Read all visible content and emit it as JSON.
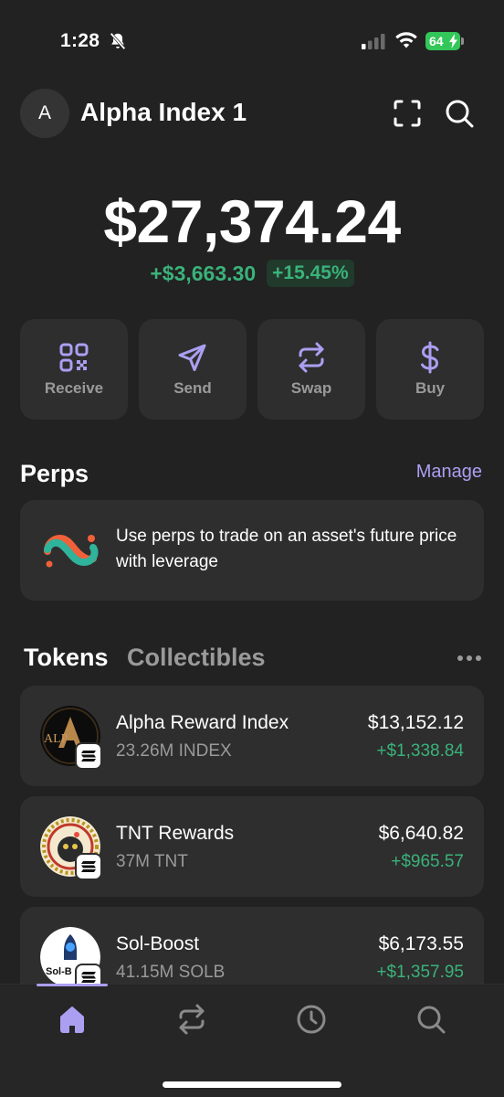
{
  "status_bar": {
    "time": "1:28",
    "battery": "64"
  },
  "header": {
    "avatar_letter": "A",
    "account_name": "Alpha Index 1"
  },
  "balance": {
    "total": "$27,374.24",
    "change_amount": "+$3,663.30",
    "change_percent": "+15.45%"
  },
  "actions": [
    {
      "label": "Receive",
      "icon": "qr-code-icon"
    },
    {
      "label": "Send",
      "icon": "send-arrow-icon"
    },
    {
      "label": "Swap",
      "icon": "swap-arrows-icon"
    },
    {
      "label": "Buy",
      "icon": "dollar-icon"
    }
  ],
  "perps": {
    "title": "Perps",
    "manage_label": "Manage",
    "description": "Use perps to trade on an asset's future price with leverage"
  },
  "tabs": {
    "tokens": "Tokens",
    "collectibles": "Collectibles"
  },
  "tokens": [
    {
      "name": "Alpha Reward Index",
      "amount": "23.26M INDEX",
      "value": "$13,152.12",
      "change": "+$1,338.84",
      "logo_text": "ALP"
    },
    {
      "name": "TNT Rewards",
      "amount": "37M TNT",
      "value": "$6,640.82",
      "change": "+$965.57"
    },
    {
      "name": "Sol-Boost",
      "amount": "41.15M SOLB",
      "value": "$6,173.55",
      "change": "+$1,357.95",
      "logo_text": "Sol-B"
    }
  ],
  "nav": [
    "home-icon",
    "swap-icon",
    "history-clock-icon",
    "search-icon"
  ],
  "colors": {
    "background": "#222222",
    "card": "#2e2e2e",
    "accent": "#ab9ff2",
    "positive": "#3ab27a",
    "muted": "#9a9a9a"
  }
}
